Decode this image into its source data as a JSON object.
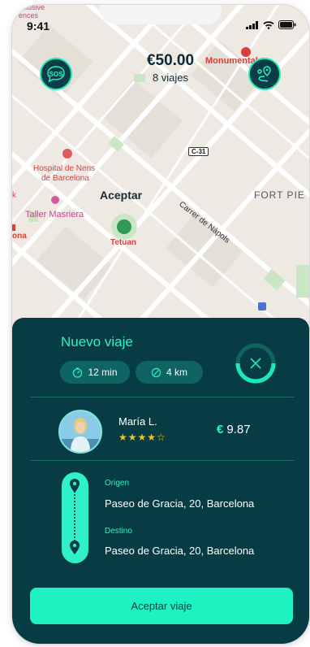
{
  "status_bar": {
    "time": "9:41"
  },
  "header": {
    "fare_amount": "€50.00",
    "trips_count": "8 viajes",
    "sos_label": "SOS"
  },
  "map": {
    "labels": {
      "top_left": "xclusive\nences",
      "monumental": "Monumental",
      "hospital_line1": "Hospital de Nens",
      "hospital_line2": "de Barcelona",
      "accept_on_map": "Aceptar",
      "fort_pie": "FORT PIE",
      "street": "Carrer de Nàpols",
      "taller": "Taller Masriera",
      "tetuan": "Tetuan",
      "ona": "ona",
      "k": "k",
      "road": "C-31"
    }
  },
  "ride": {
    "title": "Nuevo viaje",
    "duration": "12 min",
    "distance": "4 km",
    "driver_name": "María L.",
    "rating_stars": "★★★★☆",
    "currency_symbol": "€",
    "price": "9.87",
    "origin_label": "Origen",
    "origin_address": "Paseo de Gracia, 20, Barcelona",
    "destination_label": "Destino",
    "destination_address": "Paseo de Gracia, 20, Barcelona",
    "accept_label": "Aceptar viaje"
  },
  "colors": {
    "accent": "#2ff0c6",
    "sheet": "#073c45",
    "button": "#1ef2c1"
  }
}
